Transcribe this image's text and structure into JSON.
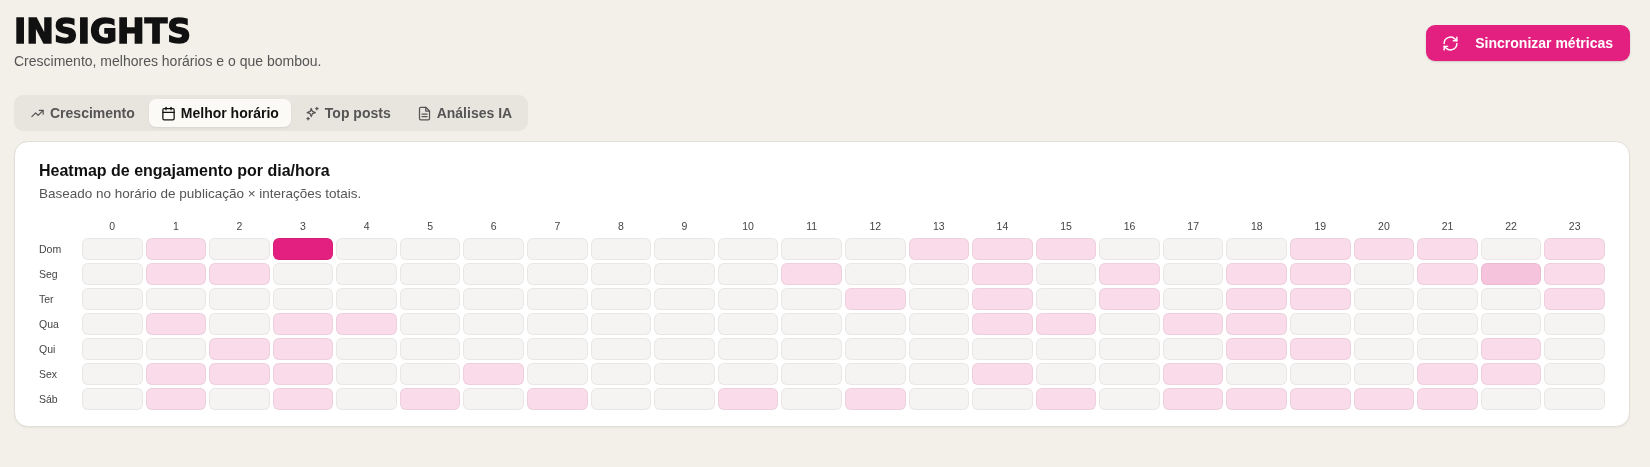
{
  "header": {
    "title": "INSIGHTS",
    "subtitle": "Crescimento, melhores horários e o que bombou."
  },
  "sync_button": {
    "label": "Sincronizar métricas"
  },
  "tabs": [
    {
      "label": "Crescimento",
      "selected": false
    },
    {
      "label": "Melhor horário",
      "selected": true
    },
    {
      "label": "Top posts",
      "selected": false
    },
    {
      "label": "Análises IA",
      "selected": false
    }
  ],
  "heatmap": {
    "title": "Heatmap de engajamento por dia/hora",
    "subtitle": "Baseado no horário de publicação × interações totais.",
    "hours": [
      "0",
      "1",
      "2",
      "3",
      "4",
      "5",
      "6",
      "7",
      "8",
      "9",
      "10",
      "11",
      "12",
      "13",
      "14",
      "15",
      "16",
      "17",
      "18",
      "19",
      "20",
      "21",
      "22",
      "23"
    ],
    "rows": [
      {
        "day": "Dom",
        "cells": [
          {
            "color": "#f5f4f2"
          },
          {
            "color": "#fadbe9"
          },
          {
            "color": "#f5f4f2"
          },
          {
            "color": "#e3207f"
          },
          {
            "color": "#f5f4f2"
          },
          {
            "color": "#f5f4f2"
          },
          {
            "color": "#f5f4f2"
          },
          {
            "color": "#f5f4f2"
          },
          {
            "color": "#f5f4f2"
          },
          {
            "color": "#f5f4f2"
          },
          {
            "color": "#f5f4f2"
          },
          {
            "color": "#f5f4f2"
          },
          {
            "color": "#f5f4f2"
          },
          {
            "color": "#fadbe9"
          },
          {
            "color": "#fadbe9"
          },
          {
            "color": "#fadbe9"
          },
          {
            "color": "#f5f4f2"
          },
          {
            "color": "#f5f4f2"
          },
          {
            "color": "#f5f4f2"
          },
          {
            "color": "#fadbe9"
          },
          {
            "color": "#fadbe9"
          },
          {
            "color": "#fadbe9"
          },
          {
            "color": "#f5f4f2"
          },
          {
            "color": "#fadbe9"
          }
        ]
      },
      {
        "day": "Seg",
        "cells": [
          {
            "color": "#f5f4f2"
          },
          {
            "color": "#fadbe9"
          },
          {
            "color": "#fadbe9"
          },
          {
            "color": "#f5f4f2"
          },
          {
            "color": "#f5f4f2"
          },
          {
            "color": "#f5f4f2"
          },
          {
            "color": "#f5f4f2"
          },
          {
            "color": "#f5f4f2"
          },
          {
            "color": "#f5f4f2"
          },
          {
            "color": "#f5f4f2"
          },
          {
            "color": "#f5f4f2"
          },
          {
            "color": "#fadbe9"
          },
          {
            "color": "#f5f4f2"
          },
          {
            "color": "#f5f4f2"
          },
          {
            "color": "#fadbe9"
          },
          {
            "color": "#f5f4f2"
          },
          {
            "color": "#fadbe9"
          },
          {
            "color": "#f5f4f2"
          },
          {
            "color": "#fadbe9"
          },
          {
            "color": "#fadbe9"
          },
          {
            "color": "#f5f4f2"
          },
          {
            "color": "#fadbe9"
          },
          {
            "color": "#f6c3dc"
          },
          {
            "color": "#fadbe9"
          }
        ]
      },
      {
        "day": "Ter",
        "cells": [
          {
            "color": "#f5f4f2"
          },
          {
            "color": "#f5f4f2"
          },
          {
            "color": "#f5f4f2"
          },
          {
            "color": "#f5f4f2"
          },
          {
            "color": "#f5f4f2"
          },
          {
            "color": "#f5f4f2"
          },
          {
            "color": "#f5f4f2"
          },
          {
            "color": "#f5f4f2"
          },
          {
            "color": "#f5f4f2"
          },
          {
            "color": "#f5f4f2"
          },
          {
            "color": "#f5f4f2"
          },
          {
            "color": "#f5f4f2"
          },
          {
            "color": "#fadbe9"
          },
          {
            "color": "#f5f4f2"
          },
          {
            "color": "#fadbe9"
          },
          {
            "color": "#f5f4f2"
          },
          {
            "color": "#fadbe9"
          },
          {
            "color": "#f5f4f2"
          },
          {
            "color": "#fadbe9"
          },
          {
            "color": "#fadbe9"
          },
          {
            "color": "#f5f4f2"
          },
          {
            "color": "#f5f4f2"
          },
          {
            "color": "#f5f4f2"
          },
          {
            "color": "#fadbe9"
          }
        ]
      },
      {
        "day": "Qua",
        "cells": [
          {
            "color": "#f5f4f2"
          },
          {
            "color": "#fadbe9"
          },
          {
            "color": "#f5f4f2"
          },
          {
            "color": "#fadbe9"
          },
          {
            "color": "#fadbe9"
          },
          {
            "color": "#f5f4f2"
          },
          {
            "color": "#f5f4f2"
          },
          {
            "color": "#f5f4f2"
          },
          {
            "color": "#f5f4f2"
          },
          {
            "color": "#f5f4f2"
          },
          {
            "color": "#f5f4f2"
          },
          {
            "color": "#f5f4f2"
          },
          {
            "color": "#f5f4f2"
          },
          {
            "color": "#f5f4f2"
          },
          {
            "color": "#fadbe9"
          },
          {
            "color": "#fadbe9"
          },
          {
            "color": "#f5f4f2"
          },
          {
            "color": "#fadbe9"
          },
          {
            "color": "#fadbe9"
          },
          {
            "color": "#f5f4f2"
          },
          {
            "color": "#f5f4f2"
          },
          {
            "color": "#f5f4f2"
          },
          {
            "color": "#f5f4f2"
          },
          {
            "color": "#f5f4f2"
          }
        ]
      },
      {
        "day": "Qui",
        "cells": [
          {
            "color": "#f5f4f2"
          },
          {
            "color": "#f5f4f2"
          },
          {
            "color": "#fadbe9"
          },
          {
            "color": "#fadbe9"
          },
          {
            "color": "#f5f4f2"
          },
          {
            "color": "#f5f4f2"
          },
          {
            "color": "#f5f4f2"
          },
          {
            "color": "#f5f4f2"
          },
          {
            "color": "#f5f4f2"
          },
          {
            "color": "#f5f4f2"
          },
          {
            "color": "#f5f4f2"
          },
          {
            "color": "#f5f4f2"
          },
          {
            "color": "#f5f4f2"
          },
          {
            "color": "#f5f4f2"
          },
          {
            "color": "#f5f4f2"
          },
          {
            "color": "#f5f4f2"
          },
          {
            "color": "#f5f4f2"
          },
          {
            "color": "#f5f4f2"
          },
          {
            "color": "#fadbe9"
          },
          {
            "color": "#fadbe9"
          },
          {
            "color": "#f5f4f2"
          },
          {
            "color": "#f5f4f2"
          },
          {
            "color": "#fadbe9"
          },
          {
            "color": "#f5f4f2"
          }
        ]
      },
      {
        "day": "Sex",
        "cells": [
          {
            "color": "#f5f4f2"
          },
          {
            "color": "#fadbe9"
          },
          {
            "color": "#fadbe9"
          },
          {
            "color": "#fadbe9"
          },
          {
            "color": "#f5f4f2"
          },
          {
            "color": "#f5f4f2"
          },
          {
            "color": "#fadbe9"
          },
          {
            "color": "#f5f4f2"
          },
          {
            "color": "#f5f4f2"
          },
          {
            "color": "#f5f4f2"
          },
          {
            "color": "#f5f4f2"
          },
          {
            "color": "#f5f4f2"
          },
          {
            "color": "#f5f4f2"
          },
          {
            "color": "#f5f4f2"
          },
          {
            "color": "#fadbe9"
          },
          {
            "color": "#f5f4f2"
          },
          {
            "color": "#f5f4f2"
          },
          {
            "color": "#fadbe9"
          },
          {
            "color": "#f5f4f2"
          },
          {
            "color": "#f5f4f2"
          },
          {
            "color": "#f5f4f2"
          },
          {
            "color": "#fadbe9"
          },
          {
            "color": "#fadbe9"
          },
          {
            "color": "#f5f4f2"
          }
        ]
      },
      {
        "day": "Sáb",
        "cells": [
          {
            "color": "#f5f4f2"
          },
          {
            "color": "#fadbe9"
          },
          {
            "color": "#f5f4f2"
          },
          {
            "color": "#fadbe9"
          },
          {
            "color": "#f5f4f2"
          },
          {
            "color": "#fadbe9"
          },
          {
            "color": "#f5f4f2"
          },
          {
            "color": "#fadbe9"
          },
          {
            "color": "#f5f4f2"
          },
          {
            "color": "#f5f4f2"
          },
          {
            "color": "#fadbe9"
          },
          {
            "color": "#f5f4f2"
          },
          {
            "color": "#fadbe9"
          },
          {
            "color": "#f5f4f2"
          },
          {
            "color": "#f5f4f2"
          },
          {
            "color": "#fadbe9"
          },
          {
            "color": "#f5f4f2"
          },
          {
            "color": "#fadbe9"
          },
          {
            "color": "#fadbe9"
          },
          {
            "color": "#fadbe9"
          },
          {
            "color": "#fadbe9"
          },
          {
            "color": "#fadbe9"
          },
          {
            "color": "#f5f4f2"
          },
          {
            "color": "#f5f4f2"
          }
        ]
      }
    ]
  }
}
